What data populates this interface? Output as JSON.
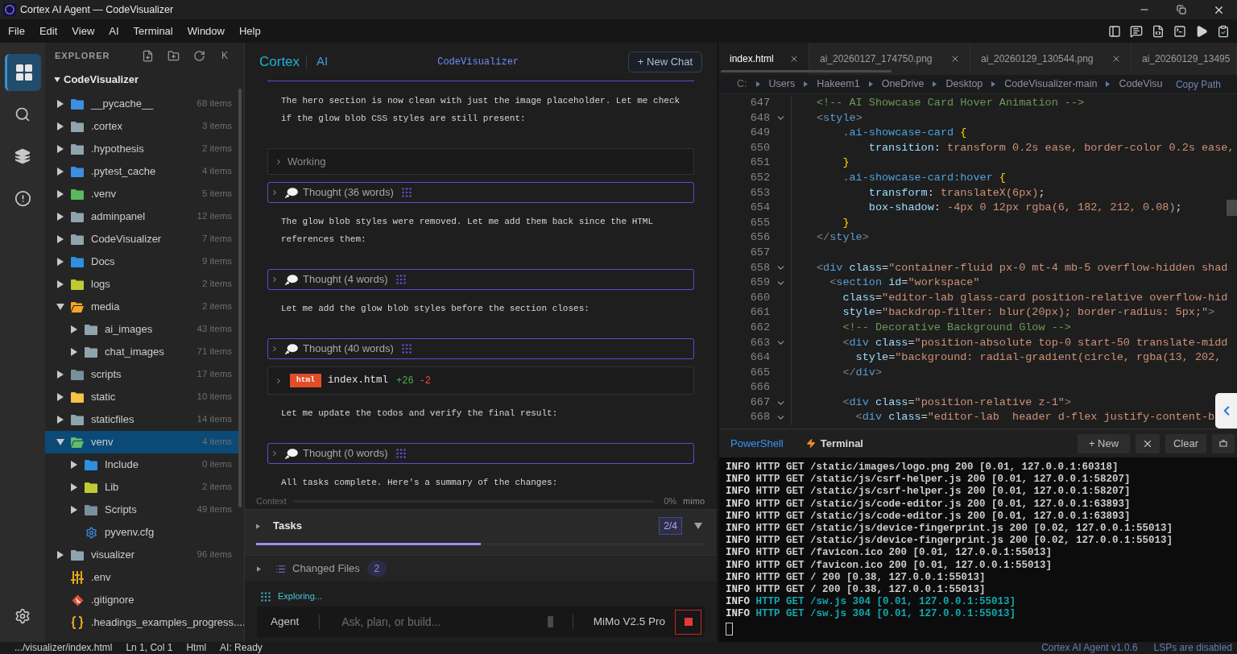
{
  "window": {
    "title": "Cortex AI Agent — CodeVisualizer"
  },
  "menu": [
    "File",
    "Edit",
    "View",
    "AI",
    "Terminal",
    "Window",
    "Help"
  ],
  "activity_bar": [
    {
      "selected": true
    },
    {
      "selected": false
    },
    {
      "selected": false
    },
    {
      "selected": false
    }
  ],
  "explorer": {
    "title": "EXPLORER",
    "collapse_key": "K",
    "root": {
      "name": "CodeVisualizer",
      "expanded": true
    },
    "items": [
      {
        "name": "__pycache__",
        "count": "68 items",
        "kind": "folder",
        "color": "#3b8ee0",
        "expanded": false,
        "selected": false
      },
      {
        "name": ".cortex",
        "count": "3 items",
        "kind": "folder",
        "color": "#90a4ae",
        "expanded": false,
        "selected": false
      },
      {
        "name": ".hypothesis",
        "count": "2 items",
        "kind": "folder",
        "color": "#90a4ae",
        "expanded": false,
        "selected": false
      },
      {
        "name": ".pytest_cache",
        "count": "4 items",
        "kind": "folder",
        "color": "#3b8ee0",
        "expanded": false,
        "selected": false
      },
      {
        "name": ".venv",
        "count": "5 items",
        "kind": "folder",
        "color": "#5cb85c",
        "expanded": false,
        "selected": false
      },
      {
        "name": "adminpanel",
        "count": "12 items",
        "kind": "folder",
        "color": "#90a4ae",
        "expanded": false,
        "selected": false
      },
      {
        "name": "CodeVisualizer",
        "count": "7 items",
        "kind": "folder",
        "color": "#90a4ae",
        "expanded": false,
        "selected": false
      },
      {
        "name": "Docs",
        "count": "9 items",
        "kind": "folder",
        "color": "#2d8fe0",
        "expanded": false,
        "selected": false
      },
      {
        "name": "logs",
        "count": "2 items",
        "kind": "folder",
        "color": "#c0ca33",
        "expanded": false,
        "selected": false
      },
      {
        "name": "media",
        "count": "2 items",
        "kind": "folder",
        "color": "#f5a623",
        "expanded": true,
        "selected": false,
        "children": [
          {
            "name": "ai_images",
            "count": "43 items",
            "kind": "folder",
            "color": "#90a4ae",
            "expanded": false,
            "selected": false
          },
          {
            "name": "chat_images",
            "count": "71 items",
            "kind": "folder",
            "color": "#90a4ae",
            "expanded": false,
            "selected": false
          }
        ]
      },
      {
        "name": "scripts",
        "count": "17 items",
        "kind": "folder",
        "color": "#78909c",
        "expanded": false,
        "selected": false
      },
      {
        "name": "static",
        "count": "10 items",
        "kind": "folder",
        "color": "#f6c344",
        "expanded": false,
        "selected": false
      },
      {
        "name": "staticfiles",
        "count": "14 items",
        "kind": "folder",
        "color": "#90a4ae",
        "expanded": false,
        "selected": false
      },
      {
        "name": "venv",
        "count": "4 items",
        "kind": "folder",
        "color": "#66bb6a",
        "expanded": true,
        "selected": true,
        "children": [
          {
            "name": "Include",
            "count": "0 items",
            "kind": "folder",
            "color": "#2d8fe0",
            "expanded": false,
            "selected": false
          },
          {
            "name": "Lib",
            "count": "2 items",
            "kind": "folder",
            "color": "#c0ca33",
            "expanded": false,
            "selected": false
          },
          {
            "name": "Scripts",
            "count": "49 items",
            "kind": "folder",
            "color": "#78909c",
            "expanded": false,
            "selected": false
          },
          {
            "name": "pyvenv.cfg",
            "kind": "gear",
            "color": "#3b8ee0",
            "selected": false
          }
        ]
      },
      {
        "name": "visualizer",
        "count": "96 items",
        "kind": "folder",
        "color": "#90a4ae",
        "expanded": false,
        "selected": false
      },
      {
        "name": ".env",
        "kind": "sliders",
        "color": "#e6a817",
        "selected": false
      },
      {
        "name": ".gitignore",
        "kind": "git",
        "color": "#e0512c",
        "selected": false
      },
      {
        "name": ".headings_examples_progress....",
        "kind": "braces",
        "color": "#e6a817",
        "selected": false
      }
    ]
  },
  "chat": {
    "brand": "Cortex",
    "brand_suffix": "AI",
    "project": "CodeVisualizer",
    "new_chat": "+ New Chat",
    "messages": [
      {
        "kind": "text",
        "text": "The hero section is now clean with just the image placeholder. Let me check if the glow blob CSS styles are still present:"
      },
      {
        "kind": "working",
        "label": "Working",
        "expanded": false
      },
      {
        "kind": "thought",
        "label": "Thought (36 words)",
        "expanded": false
      },
      {
        "kind": "text",
        "text": "The glow blob styles were removed. Let me add them back since the HTML references them:"
      },
      {
        "kind": "thought",
        "label": "Thought (4 words)",
        "expanded": false
      },
      {
        "kind": "text",
        "text": "Let me add the glow blob styles before the section closes:"
      },
      {
        "kind": "thought",
        "label": "Thought (40 words)",
        "expanded": false
      },
      {
        "kind": "file_edit",
        "badge": "html",
        "file": "index.html",
        "added": "+26",
        "removed": "-2",
        "expanded": false
      },
      {
        "kind": "text",
        "text": "Let me update the todos and verify the final result:"
      },
      {
        "kind": "thought",
        "label": "Thought (0 words)",
        "expanded": false
      },
      {
        "kind": "text",
        "text": "All tasks complete. Here's a summary of the changes:"
      }
    ],
    "context": {
      "label": "Context",
      "level": 0,
      "reading": "0%",
      "model": "mimo"
    },
    "tasks": {
      "label": "Tasks",
      "expanded": false,
      "count": "2/4",
      "level": 0.5
    },
    "changed_files": {
      "label": "Changed Files",
      "expanded": false,
      "count": "2"
    },
    "activity": "Exploring...",
    "input": {
      "mode": "Agent",
      "placeholder": "Ask, plan, or build...",
      "model": "MiMo V2.5 Pro"
    }
  },
  "editor": {
    "tabs": [
      {
        "label": "index.html",
        "selected": true
      },
      {
        "label": "ai_20260127_174750.png",
        "selected": false
      },
      {
        "label": "ai_20260129_130544.png",
        "selected": false
      },
      {
        "label": "ai_20260129_13495",
        "selected": false
      }
    ],
    "breadcrumb": [
      "C:",
      "Users",
      "Hakeem1",
      "OneDrive",
      "Desktop",
      "CodeVisualizer-main",
      "CodeVisu"
    ],
    "copy_path": "Copy Path",
    "lines": [
      {
        "number": "647",
        "tokens": [
          {
            "text": "<!-- AI Showcase Card Hover Animation -->",
            "kind": "comment"
          }
        ]
      },
      {
        "number": "648",
        "expanded": true,
        "tokens": [
          {
            "text": "<",
            "kind": "bracket"
          },
          {
            "text": "style",
            "kind": "tag"
          },
          {
            "text": ">",
            "kind": "bracket"
          }
        ]
      },
      {
        "number": "649",
        "tokens": [
          {
            "text": "    .ai-showcase-card",
            "kind": "selector"
          },
          {
            "text": " {",
            "kind": "brace"
          }
        ]
      },
      {
        "number": "650",
        "tokens": [
          {
            "text": "        transition",
            "kind": "property"
          },
          {
            "text": ": ",
            "kind": "punct"
          },
          {
            "text": "transform 0.2s ease, border-color 0.2s ease,",
            "kind": "value"
          }
        ]
      },
      {
        "number": "651",
        "tokens": [
          {
            "text": "    }",
            "kind": "brace"
          }
        ]
      },
      {
        "number": "652",
        "tokens": [
          {
            "text": "    .ai-showcase-card:hover",
            "kind": "selector"
          },
          {
            "text": " {",
            "kind": "brace"
          }
        ]
      },
      {
        "number": "653",
        "tokens": [
          {
            "text": "        transform",
            "kind": "property"
          },
          {
            "text": ": ",
            "kind": "punct"
          },
          {
            "text": "translateX(6px)",
            "kind": "value"
          },
          {
            "text": ";",
            "kind": "punct"
          }
        ]
      },
      {
        "number": "654",
        "tokens": [
          {
            "text": "        box-shadow",
            "kind": "property"
          },
          {
            "text": ": ",
            "kind": "punct"
          },
          {
            "text": "-4px 0 12px rgba(6, 182, 212, 0.08)",
            "kind": "value"
          },
          {
            "text": ";",
            "kind": "punct"
          }
        ]
      },
      {
        "number": "655",
        "tokens": [
          {
            "text": "    }",
            "kind": "brace"
          }
        ]
      },
      {
        "number": "656",
        "tokens": [
          {
            "text": "</",
            "kind": "bracket"
          },
          {
            "text": "style",
            "kind": "tag"
          },
          {
            "text": ">",
            "kind": "bracket"
          }
        ]
      },
      {
        "number": "657"
      },
      {
        "number": "658",
        "expanded": true,
        "tokens": [
          {
            "text": "<",
            "kind": "bracket"
          },
          {
            "text": "div",
            "kind": "tag"
          },
          {
            "text": " class",
            "kind": "attr"
          },
          {
            "text": "=",
            "kind": "punct"
          },
          {
            "text": "\"container-fluid px-0 mt-4 mb-5 overflow-hidden shad",
            "kind": "string"
          }
        ]
      },
      {
        "number": "659",
        "expanded": true,
        "tokens": [
          {
            "text": "  <",
            "kind": "bracket"
          },
          {
            "text": "section",
            "kind": "tag"
          },
          {
            "text": " id",
            "kind": "attr"
          },
          {
            "text": "=",
            "kind": "punct"
          },
          {
            "text": "\"workspace\"",
            "kind": "string"
          }
        ]
      },
      {
        "number": "660",
        "tokens": [
          {
            "text": "    class",
            "kind": "attr"
          },
          {
            "text": "=",
            "kind": "punct"
          },
          {
            "text": "\"editor-lab glass-card position-relative overflow-hid",
            "kind": "string"
          }
        ]
      },
      {
        "number": "661",
        "tokens": [
          {
            "text": "    style",
            "kind": "attr"
          },
          {
            "text": "=",
            "kind": "punct"
          },
          {
            "text": "\"backdrop-filter: blur(20px); border-radius: 5px;\"",
            "kind": "string"
          },
          {
            "text": ">",
            "kind": "bracket"
          }
        ]
      },
      {
        "number": "662",
        "tokens": [
          {
            "text": "    <!-- Decorative Background Glow -->",
            "kind": "comment"
          }
        ]
      },
      {
        "number": "663",
        "expanded": true,
        "tokens": [
          {
            "text": "    <",
            "kind": "bracket"
          },
          {
            "text": "div",
            "kind": "tag"
          },
          {
            "text": " class",
            "kind": "attr"
          },
          {
            "text": "=",
            "kind": "punct"
          },
          {
            "text": "\"position-absolute top-0 start-50 translate-midd",
            "kind": "string"
          }
        ]
      },
      {
        "number": "664",
        "tokens": [
          {
            "text": "      style",
            "kind": "attr"
          },
          {
            "text": "=",
            "kind": "punct"
          },
          {
            "text": "\"background: radial-gradient(circle, rgba(13, 202,",
            "kind": "string"
          }
        ]
      },
      {
        "number": "665",
        "tokens": [
          {
            "text": "    </",
            "kind": "bracket"
          },
          {
            "text": "div",
            "kind": "tag"
          },
          {
            "text": ">",
            "kind": "bracket"
          }
        ]
      },
      {
        "number": "666"
      },
      {
        "number": "667",
        "expanded": true,
        "tokens": [
          {
            "text": "    <",
            "kind": "bracket"
          },
          {
            "text": "div",
            "kind": "tag"
          },
          {
            "text": " class",
            "kind": "attr"
          },
          {
            "text": "=",
            "kind": "punct"
          },
          {
            "text": "\"position-relative z-1\"",
            "kind": "string"
          },
          {
            "text": ">",
            "kind": "bracket"
          }
        ]
      },
      {
        "number": "668",
        "expanded": true,
        "tokens": [
          {
            "text": "      <",
            "kind": "bracket"
          },
          {
            "text": "div",
            "kind": "tag"
          },
          {
            "text": " class",
            "kind": "attr"
          },
          {
            "text": "=",
            "kind": "punct"
          },
          {
            "text": "\"editor-lab  header d-flex justify-content-b",
            "kind": "string"
          }
        ]
      }
    ]
  },
  "terminal": {
    "tabs": [
      {
        "label": "PowerShell",
        "selected": false
      },
      {
        "label": "Terminal",
        "selected": true
      }
    ],
    "new_button": "+ New",
    "clear_button": "Clear",
    "lines": [
      {
        "level": "INFO",
        "message": "HTTP GET /static/images/logo.png 200 [0.01, 127.0.0.1:60318]",
        "kind": "ok"
      },
      {
        "level": "INFO",
        "message": "HTTP GET /static/js/csrf-helper.js 200 [0.01, 127.0.0.1:58207]",
        "kind": "ok"
      },
      {
        "level": "INFO",
        "message": "HTTP GET /static/js/csrf-helper.js 200 [0.01, 127.0.0.1:58207]",
        "kind": "ok"
      },
      {
        "level": "INFO",
        "message": "HTTP GET /static/js/code-editor.js 200 [0.01, 127.0.0.1:63893]",
        "kind": "ok"
      },
      {
        "level": "INFO",
        "message": "HTTP GET /static/js/code-editor.js 200 [0.01, 127.0.0.1:63893]",
        "kind": "ok"
      },
      {
        "level": "INFO",
        "message": "HTTP GET /static/js/device-fingerprint.js 200 [0.02, 127.0.0.1:55013]",
        "kind": "ok"
      },
      {
        "level": "INFO",
        "message": "HTTP GET /static/js/device-fingerprint.js 200 [0.02, 127.0.0.1:55013]",
        "kind": "ok"
      },
      {
        "level": "INFO",
        "message": "HTTP GET /favicon.ico 200 [0.01, 127.0.0.1:55013]",
        "kind": "ok"
      },
      {
        "level": "INFO",
        "message": "HTTP GET /favicon.ico 200 [0.01, 127.0.0.1:55013]",
        "kind": "ok"
      },
      {
        "level": "INFO",
        "message": "HTTP GET / 200 [0.38, 127.0.0.1:55013]",
        "kind": "ok"
      },
      {
        "level": "INFO",
        "message": "HTTP GET / 200 [0.38, 127.0.0.1:55013]",
        "kind": "ok"
      },
      {
        "level": "INFO",
        "message": "HTTP GET /sw.js 304 [0.01, 127.0.0.1:55013]",
        "kind": "not_modified"
      },
      {
        "level": "INFO",
        "message": "HTTP GET /sw.js 304 [0.01, 127.0.0.1:55013]",
        "kind": "not_modified"
      }
    ]
  },
  "status_bar": {
    "left": [
      ".../visualizer/index.html",
      "Ln 1, Col 1",
      "Html",
      "AI: Ready"
    ],
    "right": [
      "Cortex AI Agent v1.0.6",
      "LSPs are disabled"
    ]
  }
}
